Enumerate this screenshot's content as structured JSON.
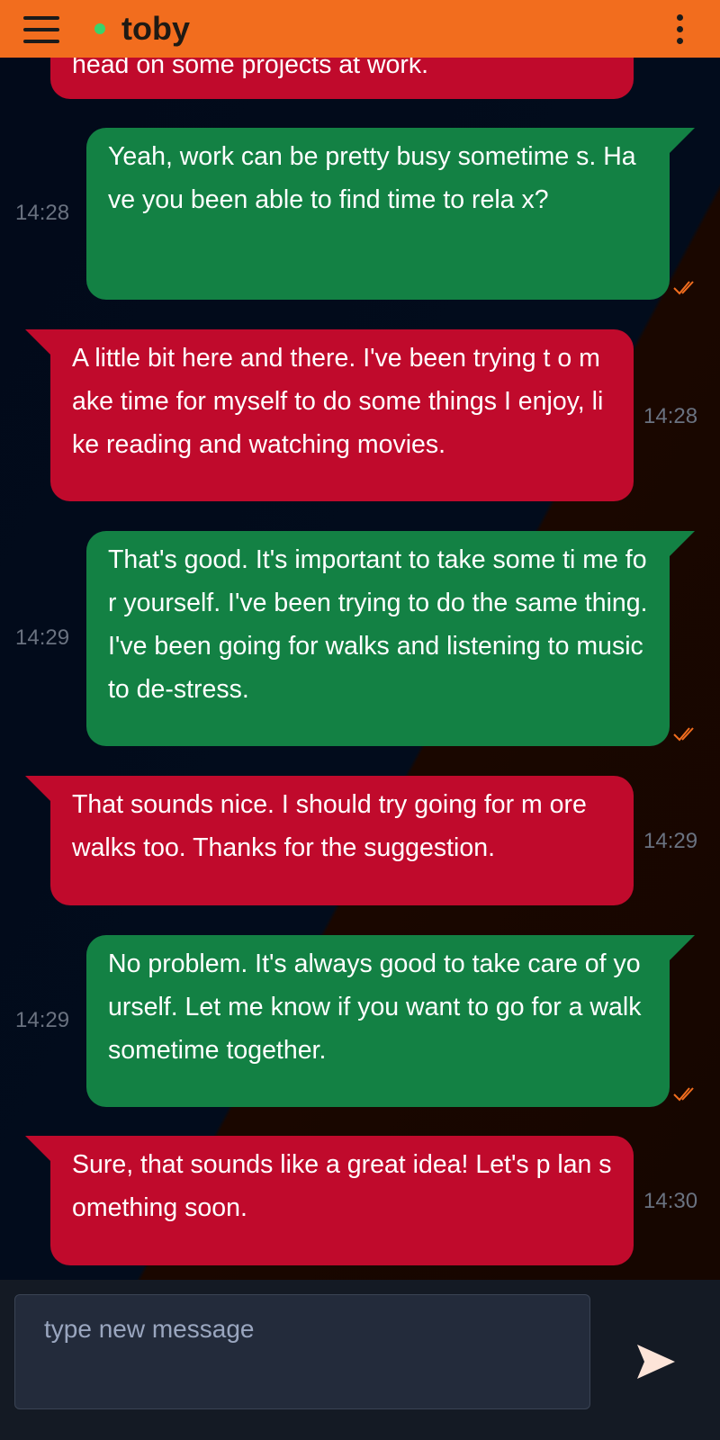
{
  "header": {
    "title": "toby",
    "menu_icon": "hamburger-menu-icon",
    "more_icon": "more-vertical-icon",
    "status": "online",
    "accent": "#f26d1e"
  },
  "messages": [
    {
      "type": "received",
      "text": "head on some projects at work.",
      "time": ""
    },
    {
      "type": "sent",
      "text": "Yeah, work can be pretty busy sometime s. Have you been able to find time to rela x?",
      "time": "14:28",
      "read": true
    },
    {
      "type": "received",
      "text": "A little bit here and there. I've been trying t o make time for myself to do some things I enjoy, like reading and watching movies.",
      "time": "14:28"
    },
    {
      "type": "sent",
      "text": "That's good. It's important to take some ti me for yourself. I've been trying to do the same thing. I've been going for walks and listening to music to de-stress.",
      "time": "14:29",
      "read": true
    },
    {
      "type": "received",
      "text": "That sounds nice. I should try going for m ore walks too. Thanks for the suggestion.",
      "time": "14:29"
    },
    {
      "type": "sent",
      "text": "No problem. It's always good to take care of yourself. Let me know if you want to go for a walk sometime together.",
      "time": "14:29",
      "read": true
    },
    {
      "type": "received",
      "text": "Sure, that sounds like a great idea! Let's p lan something soon.",
      "time": "14:30"
    }
  ],
  "composer": {
    "placeholder": "type new message",
    "send_icon": "send-icon"
  },
  "colors": {
    "received_bubble": "#c00a2c",
    "sent_bubble": "#138144",
    "read_check": "#f26d1e"
  }
}
